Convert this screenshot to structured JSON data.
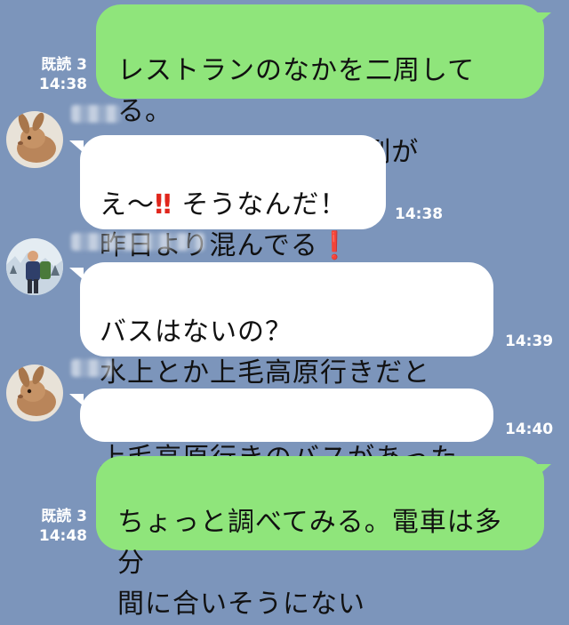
{
  "colors": {
    "background": "#7c95bb",
    "outgoing_bubble": "#8fe57b",
    "incoming_bubble": "#ffffff",
    "meta_text": "#ffffff"
  },
  "messages": [
    {
      "direction": "outgoing",
      "text": "レストランのなかを二周してる。\nロープウェイ待ちの列が",
      "read_label": "既読 3",
      "time": "14:38"
    },
    {
      "direction": "incoming",
      "avatar_icon": "rabbit-avatar-icon",
      "line1_prefix": "え〜",
      "line1_emoji": "‼",
      "line1_suffix": " そうなんだ！",
      "line2_text": "昨日より混んでる",
      "line2_emoji": "❗",
      "time": "14:38"
    },
    {
      "direction": "incoming",
      "avatar_icon": "hiker-avatar-icon",
      "text": "バスはないの？\n水上とか上毛高原行きだとか。",
      "time": "14:39"
    },
    {
      "direction": "incoming",
      "avatar_icon": "rabbit-avatar-icon",
      "text": "上毛高原行きのバスがあったよ",
      "time": "14:40"
    },
    {
      "direction": "outgoing",
      "text": "ちょっと調べてみる。電車は多分\n間に合いそうにない",
      "read_label": "既読 3",
      "time": "14:48"
    }
  ]
}
